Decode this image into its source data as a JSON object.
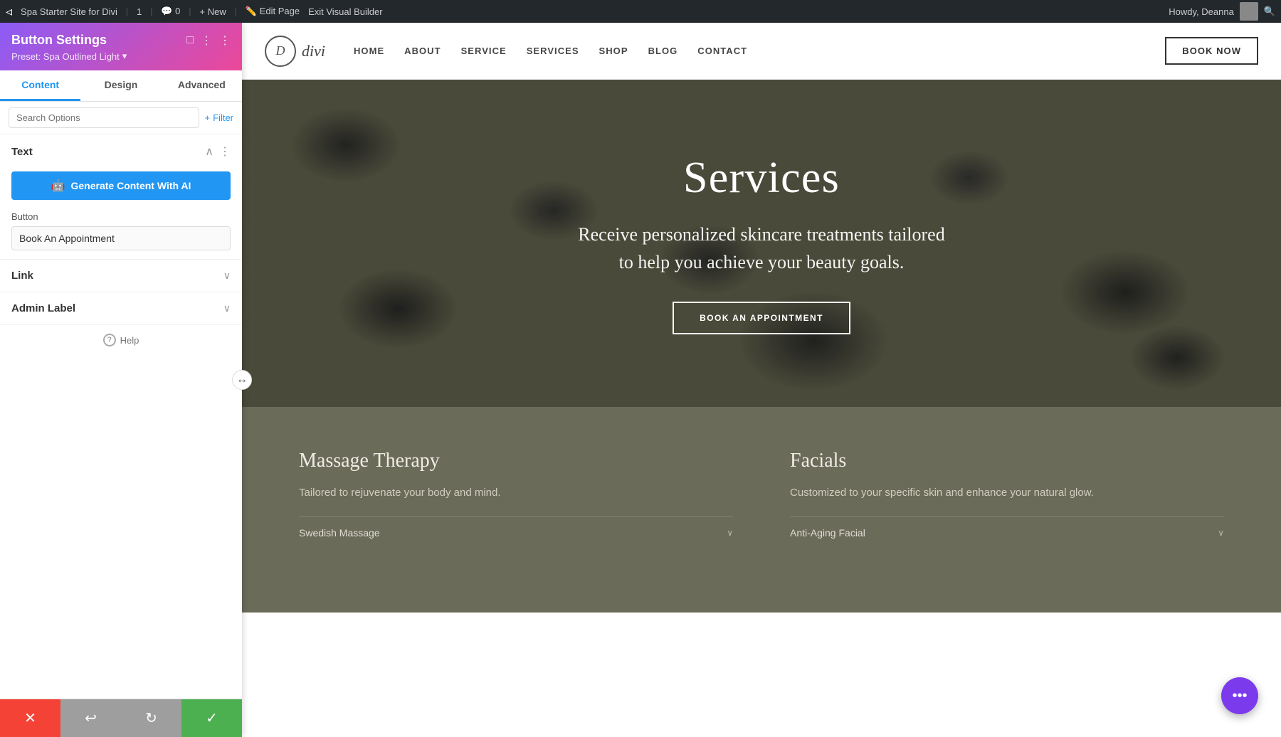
{
  "admin_bar": {
    "wp_icon": "W",
    "site_name": "Spa Starter Site for Divi",
    "updates": "1",
    "comments": "0",
    "new_label": "+ New",
    "edit_page_label": "Edit Page",
    "exit_builder_label": "Exit Visual Builder",
    "howdy": "Howdy, Deanna"
  },
  "panel": {
    "title": "Button Settings",
    "preset_label": "Preset: Spa Outlined Light",
    "tabs": [
      {
        "id": "content",
        "label": "Content"
      },
      {
        "id": "design",
        "label": "Design"
      },
      {
        "id": "advanced",
        "label": "Advanced"
      }
    ],
    "search_placeholder": "Search Options",
    "filter_label": "Filter",
    "sections": {
      "text": {
        "title": "Text",
        "ai_button_label": "Generate Content With AI",
        "button_field_label": "Button",
        "button_field_value": "Book An Appointment"
      },
      "link": {
        "title": "Link"
      },
      "admin_label": {
        "title": "Admin Label"
      }
    },
    "help_label": "Help",
    "footer": {
      "cancel_icon": "✕",
      "undo_icon": "↩",
      "redo_icon": "↻",
      "save_icon": "✓"
    }
  },
  "site": {
    "nav": {
      "logo_letter": "D",
      "logo_name": "divi",
      "links": [
        "HOME",
        "ABOUT",
        "SERVICE",
        "SERVICES",
        "SHOP",
        "BLOG",
        "CONTACT"
      ],
      "book_btn": "BOOK NOW"
    },
    "hero": {
      "title": "Services",
      "subtitle": "Receive personalized skincare treatments tailored\nto help you achieve your beauty goals.",
      "cta": "BOOK AN APPOINTMENT"
    },
    "services": [
      {
        "name": "Massage Therapy",
        "description": "Tailored to rejuvenate your body and mind.",
        "sub_items": [
          {
            "name": "Swedish Massage"
          }
        ]
      },
      {
        "name": "Facials",
        "description": "Customized to your specific skin and enhance your natural glow.",
        "sub_items": [
          {
            "name": "Anti-Aging Facial"
          }
        ]
      }
    ]
  }
}
